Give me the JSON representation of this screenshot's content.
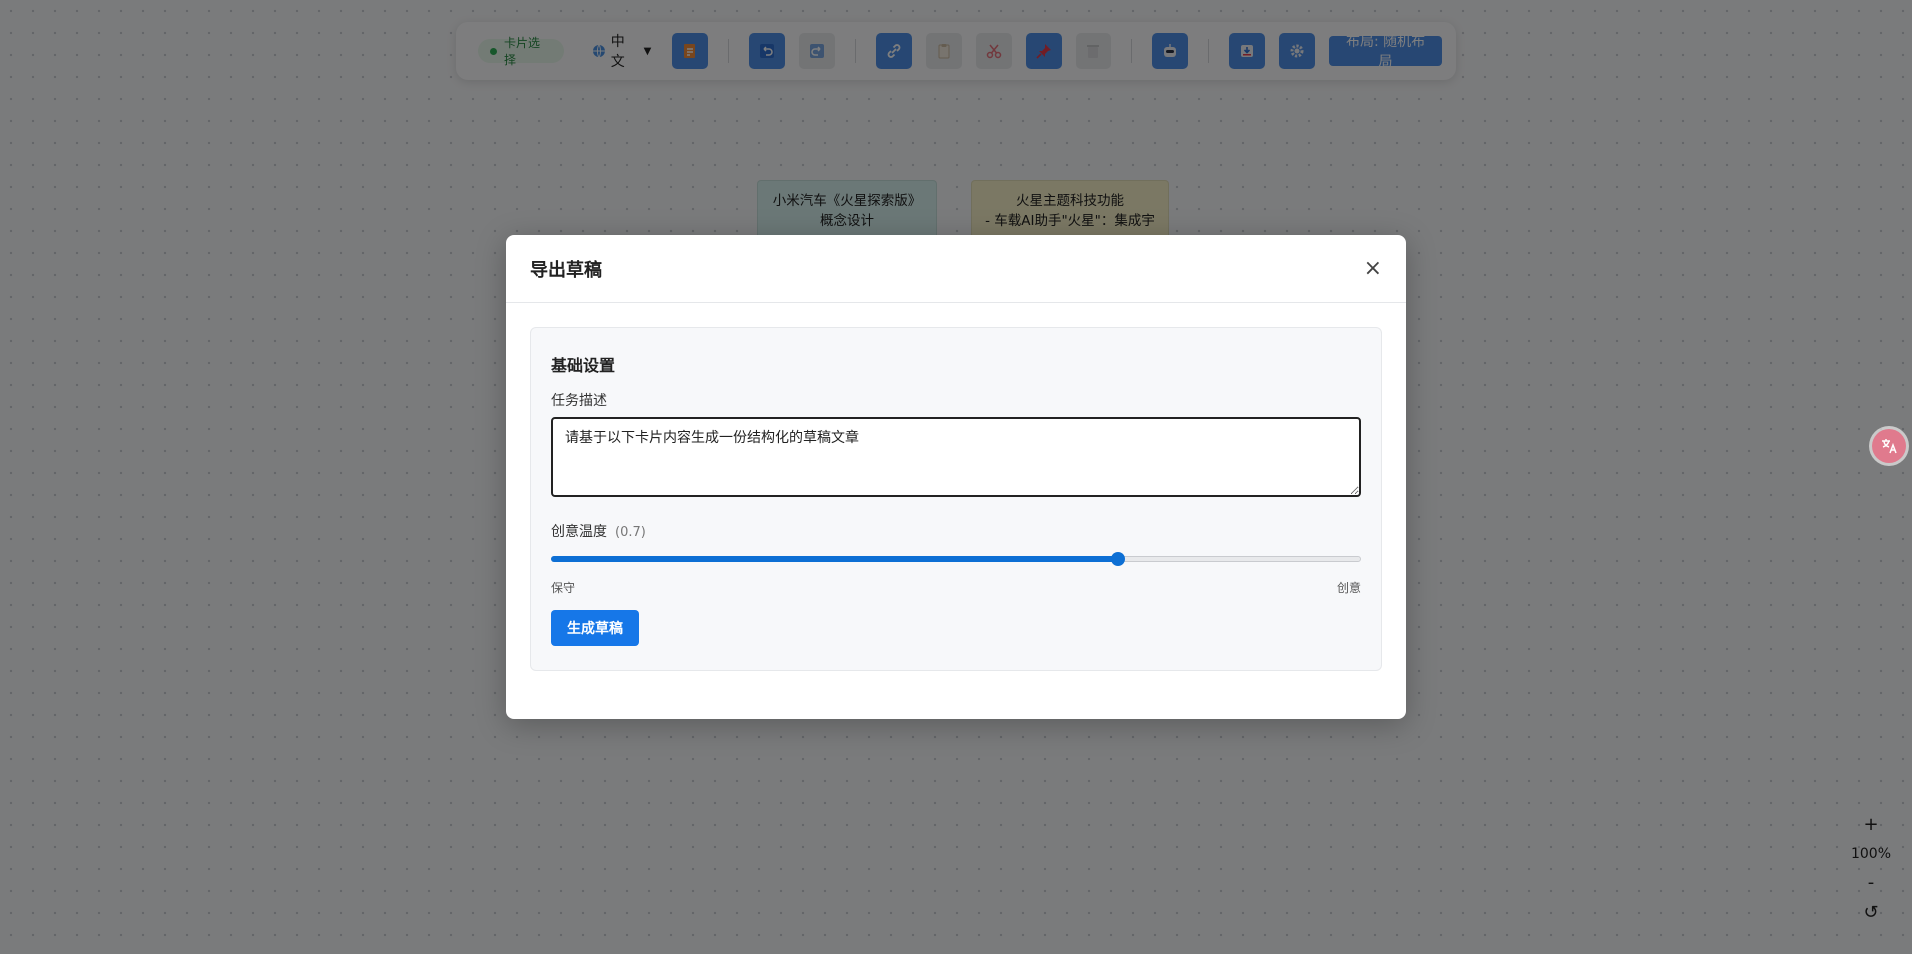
{
  "toolbar": {
    "mode_label": "卡片选择",
    "language": "中文",
    "layout_button": "布局: 随机布局"
  },
  "canvas": {
    "cards": [
      {
        "line1": "小米汽车《火星探索版》",
        "line2": "概念设计"
      },
      {
        "line1": "火星主题科技功能",
        "line2": "- 车载AI助手\"火星\"：集成宇"
      }
    ],
    "zoom": "100%",
    "zoom_in": "+",
    "zoom_out": "-",
    "reset": "↺"
  },
  "modal": {
    "title": "导出草稿",
    "close": "×",
    "section_title": "基础设置",
    "task_label": "任务描述",
    "task_value": "请基于以下卡片内容生成一份结构化的草稿文章",
    "temperature_label": "创意温度",
    "temperature_value_text": "(0.7)",
    "temperature_value": 0.7,
    "temperature_min_label": "保守",
    "temperature_max_label": "创意",
    "generate_button": "生成草稿"
  },
  "colors": {
    "primary": "#1677e8",
    "toolbar_button": "#4f8fe6",
    "mode_pill_text": "#2a8a44",
    "card1_bg": "#d6f1ee",
    "card2_bg": "#f7f1c8"
  }
}
